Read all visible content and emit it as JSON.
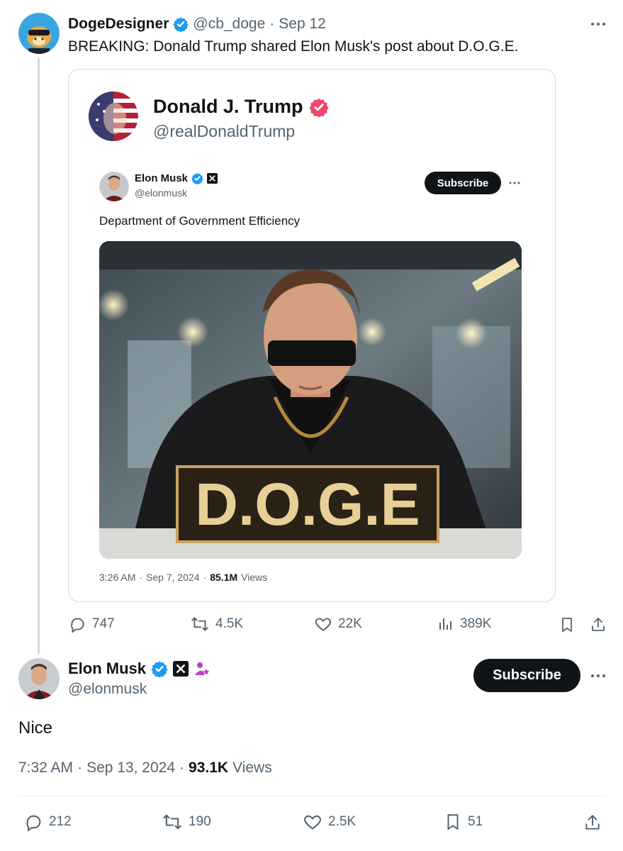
{
  "parent_post": {
    "author_name": "DogeDesigner",
    "author_handle": "@cb_doge",
    "separator": "·",
    "date": "Sep 12",
    "text": "BREAKING: Donald Trump shared Elon Musk's post about D.O.G.E.",
    "quoted": {
      "author_name": "Donald J. Trump",
      "author_handle": "@realDonaldTrump",
      "inner_post": {
        "author_name": "Elon Musk",
        "author_handle": "@elonmusk",
        "subscribe_label": "Subscribe",
        "text": "Department of Government Efficiency",
        "image_plaque_text": "D.O.G.E",
        "time": "3:26 AM",
        "date": "Sep 7, 2024",
        "views_count": "85.1M",
        "views_label": "Views"
      }
    },
    "stats": {
      "replies": "747",
      "reposts": "4.5K",
      "likes": "22K",
      "views": "389K"
    }
  },
  "reply_post": {
    "author_name": "Elon Musk",
    "author_handle": "@elonmusk",
    "subscribe_label": "Subscribe",
    "text": "Nice",
    "time": "7:32 AM",
    "date": "Sep 13, 2024",
    "views_count": "93.1K",
    "views_label": "Views",
    "stats": {
      "replies": "212",
      "reposts": "190",
      "likes": "2.5K",
      "bookmarks": "51"
    }
  },
  "colors": {
    "verified_blue": "#1d9bf0",
    "verified_red": "#e0245e",
    "muted": "#536471",
    "subscribe_bg": "#0f1419",
    "divider": "#eff3f4"
  }
}
